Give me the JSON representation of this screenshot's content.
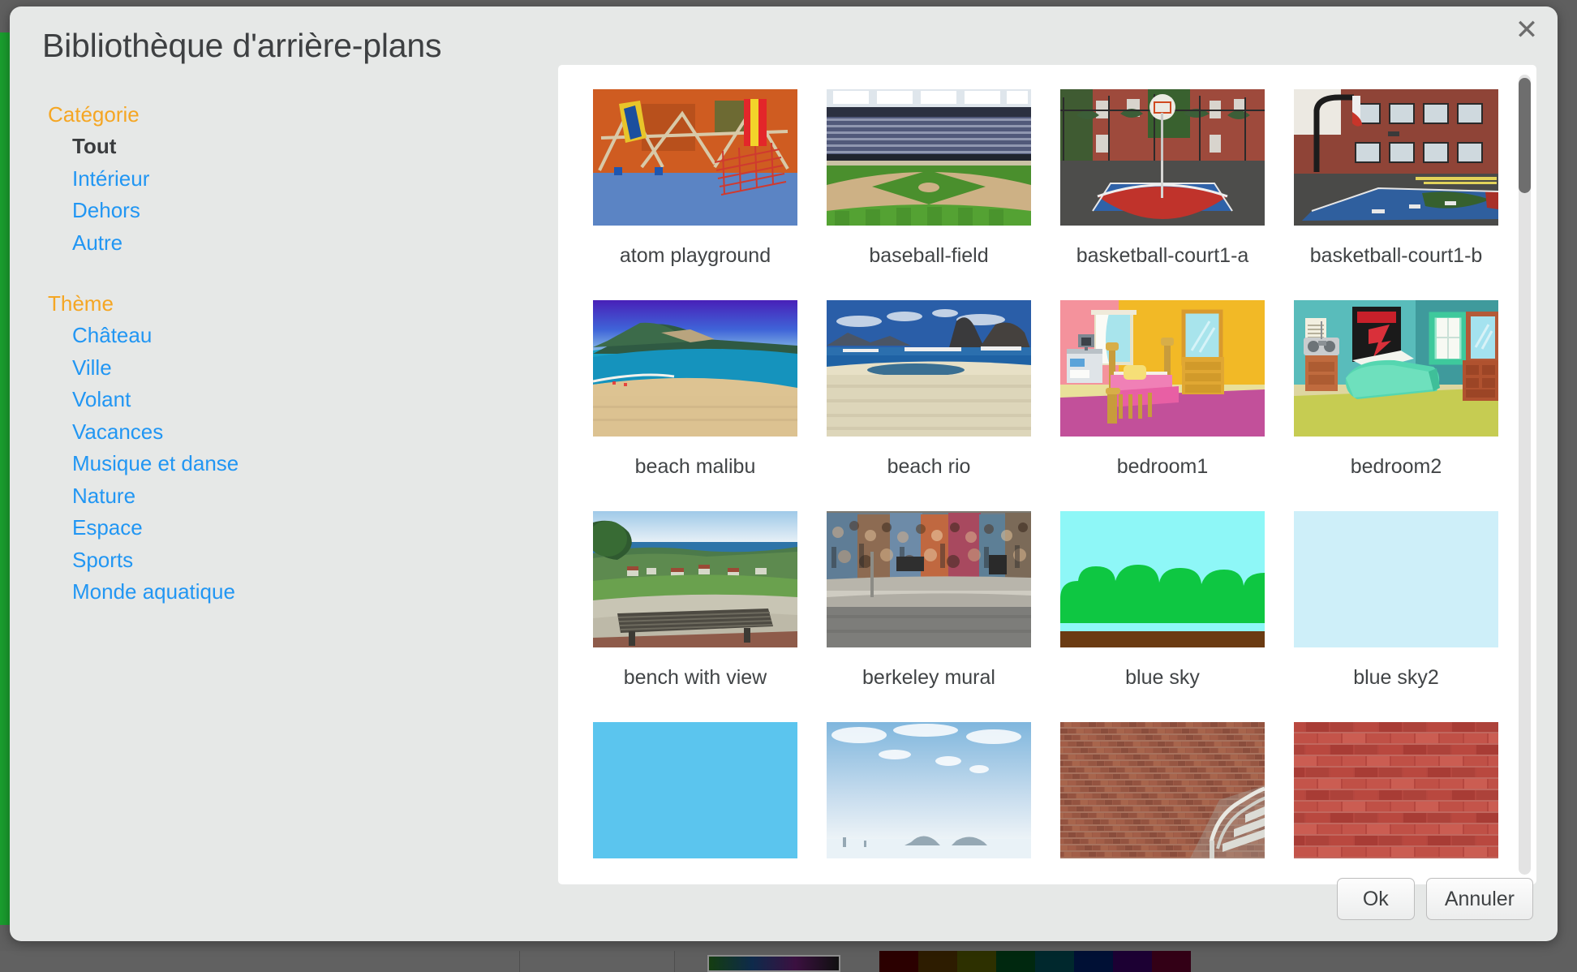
{
  "dialog": {
    "title": "Bibliothèque d'arrière-plans",
    "close_label": "✕"
  },
  "sidebar": {
    "category_heading": "Catégorie",
    "categories": [
      {
        "label": "Tout",
        "active": true
      },
      {
        "label": "Intérieur",
        "active": false
      },
      {
        "label": "Dehors",
        "active": false
      },
      {
        "label": "Autre",
        "active": false
      }
    ],
    "theme_heading": "Thème",
    "themes": [
      {
        "label": "Château"
      },
      {
        "label": "Ville"
      },
      {
        "label": "Volant"
      },
      {
        "label": "Vacances"
      },
      {
        "label": "Musique et danse"
      },
      {
        "label": "Nature"
      },
      {
        "label": "Espace"
      },
      {
        "label": "Sports"
      },
      {
        "label": "Monde aquatique"
      }
    ]
  },
  "gallery": {
    "items": [
      {
        "caption": "atom playground",
        "art": "atom-playground"
      },
      {
        "caption": "baseball-field",
        "art": "baseball-field"
      },
      {
        "caption": "basketball-court1-a",
        "art": "basketball-court-a"
      },
      {
        "caption": "basketball-court1-b",
        "art": "basketball-court-b"
      },
      {
        "caption": "beach malibu",
        "art": "beach-malibu"
      },
      {
        "caption": "beach rio",
        "art": "beach-rio"
      },
      {
        "caption": "bedroom1",
        "art": "bedroom1"
      },
      {
        "caption": "bedroom2",
        "art": "bedroom2"
      },
      {
        "caption": "bench with view",
        "art": "bench-with-view"
      },
      {
        "caption": "berkeley mural",
        "art": "berkeley-mural"
      },
      {
        "caption": "blue sky",
        "art": "blue-sky"
      },
      {
        "caption": "blue sky2",
        "art": "blue-sky2"
      },
      {
        "caption": "",
        "art": "blue-solid"
      },
      {
        "caption": "",
        "art": "sky-clouds"
      },
      {
        "caption": "",
        "art": "brick-wall-stairs"
      },
      {
        "caption": "",
        "art": "brick-wall-red"
      }
    ]
  },
  "footer": {
    "ok_label": "Ok",
    "cancel_label": "Annuler"
  },
  "colors": {
    "accent_heading": "#f5a623",
    "link": "#2196f3",
    "text": "#3e4042",
    "dialog_bg": "#e6e8e7",
    "panel_bg": "#ffffff",
    "scrollbar_thumb": "#6e6e6e"
  },
  "backdrop": {
    "swatch_colors": [
      "#2b0000",
      "#2d1c00",
      "#2d3000",
      "#00280f",
      "#00282d",
      "#001035",
      "#1c0033",
      "#330016"
    ]
  }
}
